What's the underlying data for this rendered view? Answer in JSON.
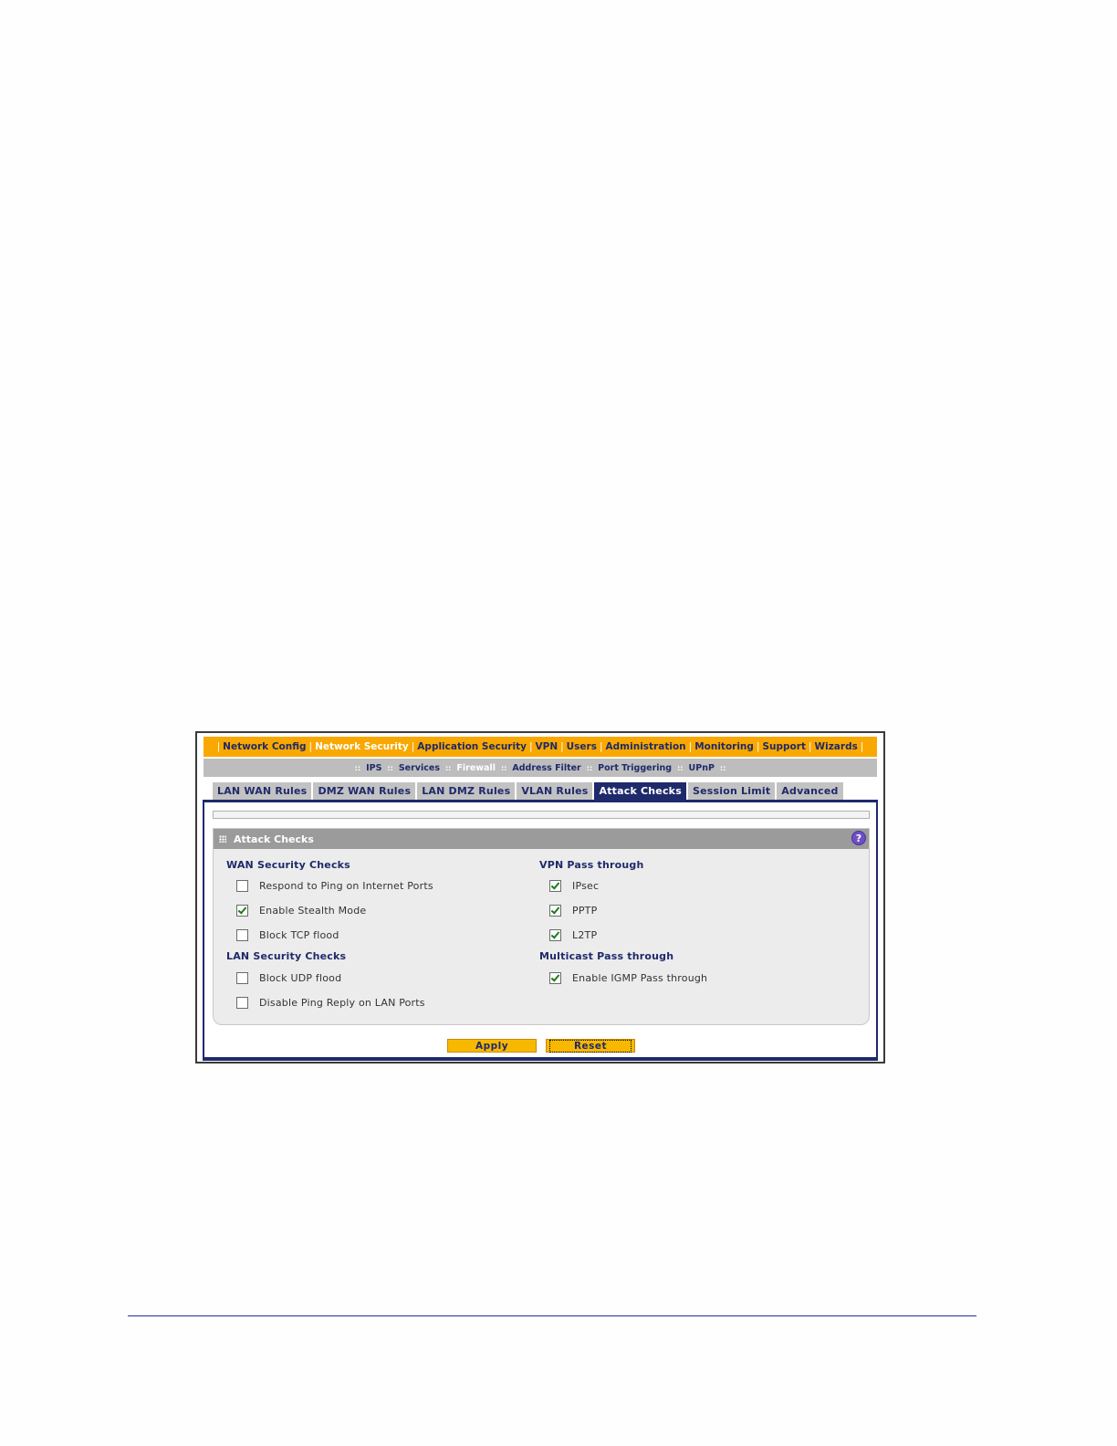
{
  "top_nav": {
    "items": [
      {
        "label": "Network Config",
        "active": false
      },
      {
        "label": "Network Security",
        "active": true
      },
      {
        "label": "Application Security",
        "active": false
      },
      {
        "label": "VPN",
        "active": false
      },
      {
        "label": "Users",
        "active": false
      },
      {
        "label": "Administration",
        "active": false
      },
      {
        "label": "Monitoring",
        "active": false
      },
      {
        "label": "Support",
        "active": false
      },
      {
        "label": "Wizards",
        "active": false
      }
    ],
    "separator": "|"
  },
  "sub_nav": {
    "items": [
      {
        "label": "IPS",
        "active": false
      },
      {
        "label": "Services",
        "active": false
      },
      {
        "label": "Firewall",
        "active": true
      },
      {
        "label": "Address Filter",
        "active": false
      },
      {
        "label": "Port Triggering",
        "active": false
      },
      {
        "label": "UPnP",
        "active": false
      }
    ],
    "separator": "::"
  },
  "tabs": [
    {
      "label": "LAN WAN Rules",
      "active": false
    },
    {
      "label": "DMZ WAN Rules",
      "active": false
    },
    {
      "label": "LAN DMZ Rules",
      "active": false
    },
    {
      "label": "VLAN Rules",
      "active": false
    },
    {
      "label": "Attack Checks",
      "active": true
    },
    {
      "label": "Session Limit",
      "active": false
    },
    {
      "label": "Advanced",
      "active": false
    }
  ],
  "panel": {
    "title": "Attack Checks",
    "help": "?",
    "wan": {
      "title": "WAN Security Checks",
      "options": [
        {
          "label": "Respond to Ping on Internet Ports",
          "checked": false
        },
        {
          "label": "Enable Stealth Mode",
          "checked": true
        },
        {
          "label": "Block TCP flood",
          "checked": false
        }
      ]
    },
    "lan": {
      "title": "LAN Security Checks",
      "options": [
        {
          "label": "Block UDP flood",
          "checked": false
        },
        {
          "label": "Disable Ping Reply on LAN Ports",
          "checked": false
        }
      ]
    },
    "vpn": {
      "title": "VPN Pass through",
      "options": [
        {
          "label": "IPsec",
          "checked": true
        },
        {
          "label": "PPTP",
          "checked": true
        },
        {
          "label": "L2TP",
          "checked": true
        }
      ]
    },
    "multicast": {
      "title": "Multicast Pass through",
      "options": [
        {
          "label": "Enable IGMP Pass through",
          "checked": true
        }
      ]
    }
  },
  "buttons": {
    "apply": "Apply",
    "reset": "Reset"
  },
  "colors": {
    "nav_orange": "#f8a800",
    "navy": "#1f2a6b",
    "subnav_gray": "#bdbdbd",
    "button_yellow": "#f8b800"
  }
}
